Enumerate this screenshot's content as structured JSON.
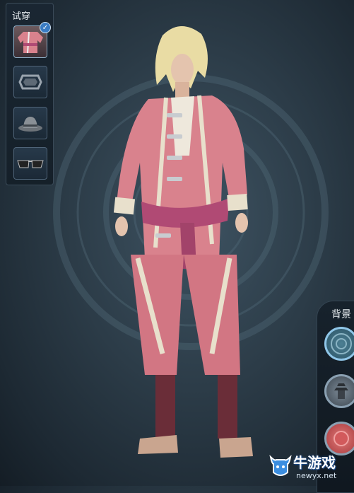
{
  "tryon": {
    "title": "试穿",
    "slots": [
      {
        "icon": "costume-icon",
        "selected": true
      },
      {
        "icon": "accessory-icon",
        "selected": false
      },
      {
        "icon": "hat-icon",
        "selected": false
      },
      {
        "icon": "glasses-icon",
        "selected": false
      }
    ]
  },
  "background": {
    "title": "背景",
    "options": [
      {
        "icon": "emblem-background-icon",
        "selected": true
      },
      {
        "icon": "temple-background-icon",
        "selected": false
      },
      {
        "icon": "red-background-icon",
        "selected": false
      }
    ]
  },
  "watermark": {
    "name": "牛游戏",
    "url": "newyx.net"
  },
  "colors": {
    "accent_blue": "#3a7cc4",
    "costume_pink": "#d9828d",
    "backdrop": "#2c3c48"
  }
}
